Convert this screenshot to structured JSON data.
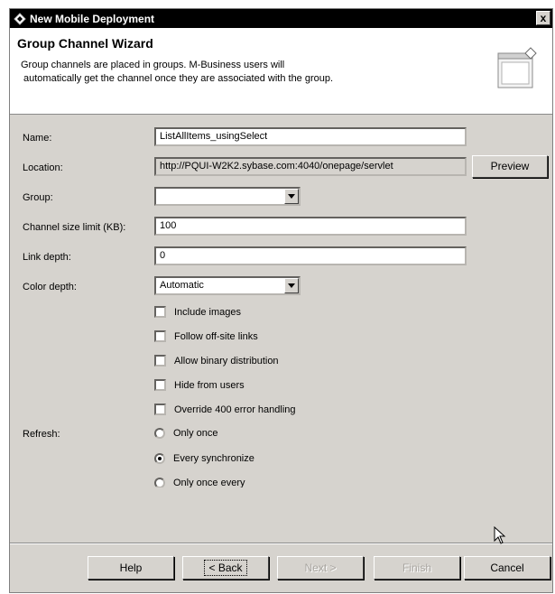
{
  "window": {
    "title": "New Mobile Deployment",
    "close_label": "x"
  },
  "header": {
    "title": "Group Channel Wizard",
    "description_line1": "Group channels are placed in groups. M-Business users will",
    "description_line2": "automatically get the channel once they are associated with the group."
  },
  "form": {
    "name_label": "Name:",
    "name_value": "ListAllItems_usingSelect",
    "location_label": "Location:",
    "location_value": "http://PQUI-W2K2.sybase.com:4040/onepage/servlet",
    "preview_label": "Preview",
    "group_label": "Group:",
    "group_value": "",
    "size_label": "Channel size limit (KB):",
    "size_value": "100",
    "link_label": "Link depth:",
    "link_value": "0",
    "color_label": "Color depth:",
    "color_value": "Automatic",
    "checkboxes": [
      {
        "label": "Include images",
        "checked": false
      },
      {
        "label": "Follow off-site links",
        "checked": false
      },
      {
        "label": "Allow binary distribution",
        "checked": false
      },
      {
        "label": "Hide from users",
        "checked": false
      },
      {
        "label": "Override 400 error handling",
        "checked": false
      }
    ],
    "refresh_label": "Refresh:",
    "refresh_options": [
      {
        "label": "Only once",
        "selected": false
      },
      {
        "label": "Every synchronize",
        "selected": true
      },
      {
        "label": "Only once every",
        "selected": false
      }
    ]
  },
  "buttons": {
    "help": "Help",
    "back": "< Back",
    "next": "Next >",
    "finish": "Finish",
    "cancel": "Cancel"
  }
}
